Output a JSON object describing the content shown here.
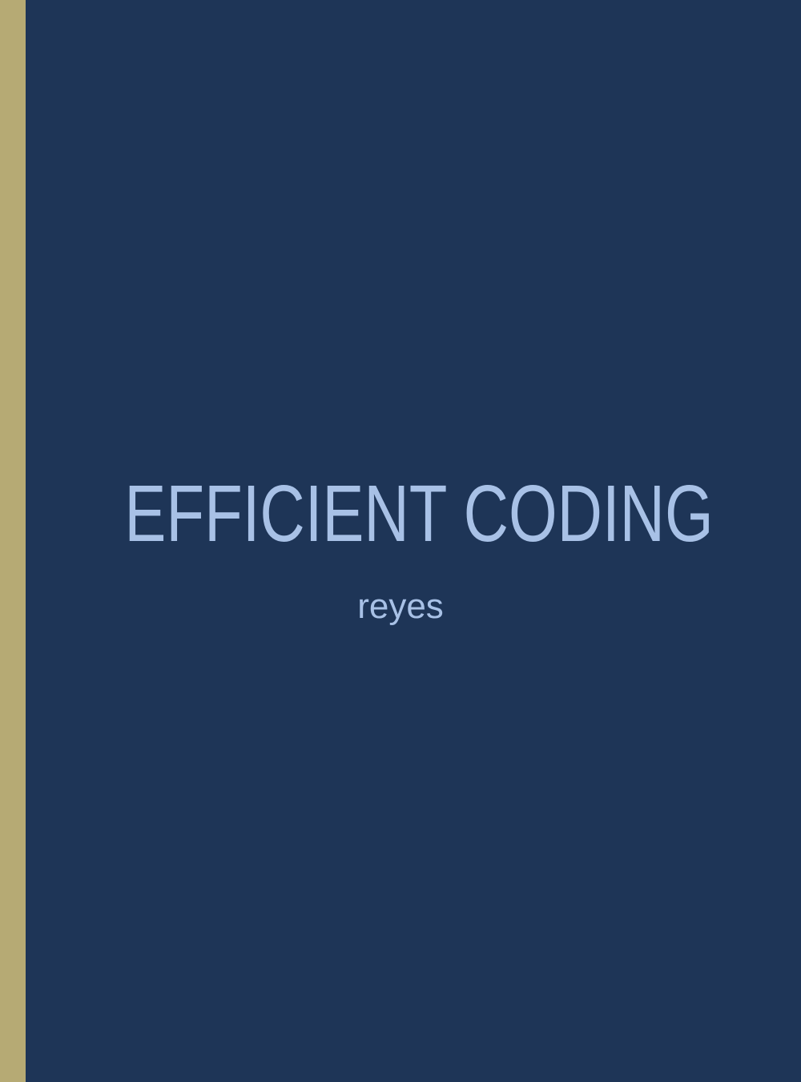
{
  "cover": {
    "title": "EFFICIENT CODING",
    "author": "reyes"
  },
  "colors": {
    "background": "#1e3557",
    "spine_band": "#b6aa74",
    "text": "#a8c1e6"
  }
}
